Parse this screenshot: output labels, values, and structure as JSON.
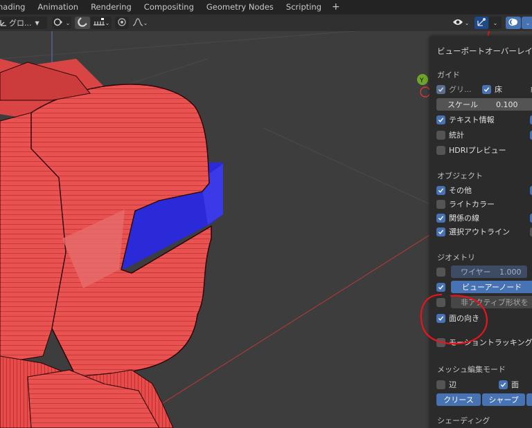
{
  "tabs": [
    "nading",
    "Animation",
    "Rendering",
    "Compositing",
    "Geometry Nodes",
    "Scripting"
  ],
  "tab_add": "+",
  "header": {
    "orientation_label": "グロ...",
    "snap_icon": "magnet-icon",
    "proportional_icon": "falloff-curve-icon"
  },
  "overlay": {
    "title": "ビューポートオーバーレイ",
    "guides": {
      "heading": "ガイド",
      "grid_label": "グリ...",
      "grid_checked": true,
      "floor_label": "床",
      "floor_checked": true,
      "scale_label": "スケール",
      "scale_value": "0.100",
      "text_info_label": "テキスト情報",
      "text_info_checked": true,
      "stats_label": "統計",
      "stats_checked": false,
      "hdri_label": "HDRIプレビュー",
      "hdri_checked": false
    },
    "objects": {
      "heading": "オブジェクト",
      "extras_label": "その他",
      "extras_checked": true,
      "light_colors_label": "ライトカラー",
      "light_colors_checked": false,
      "relationship_label": "関係の線",
      "relationship_checked": true,
      "outline_label": "選択アウトライン",
      "outline_checked": true
    },
    "geometry": {
      "heading": "ジオメトリ",
      "wireframe_label": "ワイヤー",
      "wireframe_value": "1.000",
      "wireframe_checked": false,
      "viewer_node_label": "ビューアーノード",
      "viewer_node_checked": true,
      "inactive_label": "非アクティブ形状を",
      "inactive_checked": false,
      "face_orientation_label": "面の向き",
      "face_orientation_checked": true,
      "motion_tracking_label": "モーショントラッキング",
      "motion_tracking_checked": false
    },
    "mesh_edit": {
      "heading": "メッシュ編集モード",
      "edges_label": "辺",
      "edges_checked": false,
      "faces_label": "面",
      "faces_checked": true,
      "crease_label": "クリース",
      "sharp_label": "シャープ"
    },
    "shading": {
      "heading": "シェーディング"
    }
  },
  "gizmo": {
    "y_label": "Y"
  },
  "colors": {
    "accent": "#4772b3",
    "front_face": "#ea4d4d",
    "back_face": "#2a2ad8",
    "annotation": "#e8141e",
    "background": "#3d3d3d"
  }
}
